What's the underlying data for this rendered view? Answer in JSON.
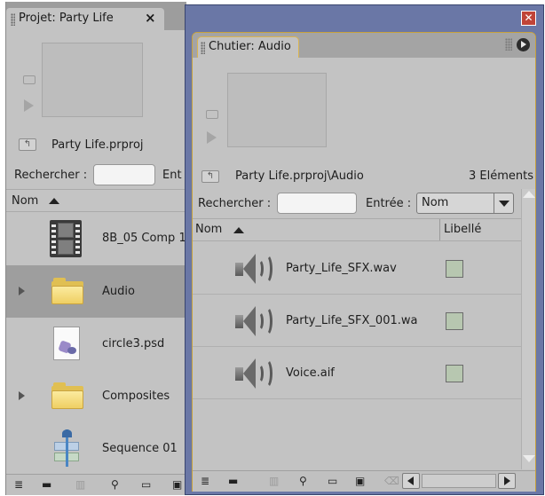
{
  "project_panel": {
    "tab_title": "Projet: Party Life",
    "close_glyph": "×",
    "project_file": "Party Life.prproj",
    "search_label": "Rechercher :",
    "entry_label_clipped": "Ent",
    "column_name": "Nom",
    "items": [
      {
        "name": "8B_05 Comp 1",
        "kind": "sequence-film",
        "expandable": false,
        "selected": false
      },
      {
        "name": "Audio",
        "kind": "folder",
        "expandable": true,
        "selected": true
      },
      {
        "name": "circle3.psd",
        "kind": "psd",
        "expandable": false,
        "selected": false
      },
      {
        "name": "Composites",
        "kind": "folder",
        "expandable": true,
        "selected": false
      },
      {
        "name": "Sequence 01",
        "kind": "sequence",
        "expandable": false,
        "selected": false
      }
    ]
  },
  "bin_window": {
    "close_glyph": "✕",
    "tab_title": "Chutier: Audio",
    "bin_path": "Party Life.prproj\\Audio",
    "element_count": "3 Eléments",
    "search_label": "Rechercher :",
    "entry_label": "Entrée :",
    "entry_value": "Nom",
    "column_name": "Nom",
    "column_label": "Libellé",
    "label_color": "#b7c7b0",
    "items": [
      {
        "name": "Party_Life_SFX.wav"
      },
      {
        "name": "Party_Life_SFX_001.wa"
      },
      {
        "name": "Voice.aif"
      }
    ]
  },
  "icons": {
    "list_view": "≣",
    "icon_view": "▬",
    "find": "⚲",
    "new_bin": "▭",
    "new_item": "▣",
    "delete": "⌫"
  }
}
